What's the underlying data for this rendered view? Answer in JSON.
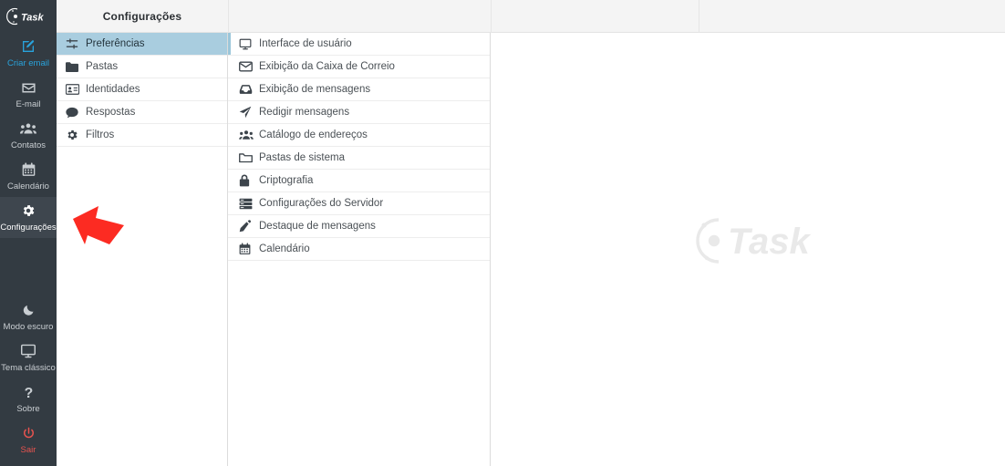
{
  "app": {
    "logo_text": "Task",
    "brand_color": "#29a3dc",
    "rail_bg": "#333b42",
    "selected_row_color": "#a9cddf",
    "logout_color": "#e8534f"
  },
  "header": {
    "title": "Configurações"
  },
  "sidebar": {
    "top_items": [
      {
        "icon": "compose-icon",
        "label": "Criar email",
        "state": "compose"
      },
      {
        "icon": "envelope-icon",
        "label": "E-mail",
        "state": "normal"
      },
      {
        "icon": "contacts-icon",
        "label": "Contatos",
        "state": "normal"
      },
      {
        "icon": "calendar-icon",
        "label": "Calendário",
        "state": "normal"
      },
      {
        "icon": "gear-icon",
        "label": "Configurações",
        "state": "active"
      }
    ],
    "bottom_items": [
      {
        "icon": "moon-icon",
        "label": "Modo escuro",
        "state": "normal"
      },
      {
        "icon": "monitor-icon",
        "label": "Tema clássico",
        "state": "normal"
      },
      {
        "icon": "question-icon",
        "label": "Sobre",
        "state": "normal"
      },
      {
        "icon": "power-icon",
        "label": "Sair",
        "state": "logout"
      }
    ]
  },
  "settings_list": {
    "items": [
      {
        "icon": "sliders-icon",
        "label": "Preferências",
        "selected": true
      },
      {
        "icon": "folder-icon",
        "label": "Pastas",
        "selected": false
      },
      {
        "icon": "idcard-icon",
        "label": "Identidades",
        "selected": false
      },
      {
        "icon": "comment-icon",
        "label": "Respostas",
        "selected": false
      },
      {
        "icon": "gear-icon",
        "label": "Filtros",
        "selected": false
      }
    ]
  },
  "preferences_sections": {
    "items": [
      {
        "icon": "monitor-icon",
        "label": "Interface de usuário",
        "active": true
      },
      {
        "icon": "envelope-icon",
        "label": "Exibição da Caixa de Correio",
        "active": false
      },
      {
        "icon": "inbox-icon",
        "label": "Exibição de mensagens",
        "active": false
      },
      {
        "icon": "send-icon",
        "label": "Redigir mensagens",
        "active": false
      },
      {
        "icon": "contacts-icon",
        "label": "Catálogo de endereços",
        "active": false
      },
      {
        "icon": "folder-open-icon",
        "label": "Pastas de sistema",
        "active": false
      },
      {
        "icon": "lock-icon",
        "label": "Criptografia",
        "active": false
      },
      {
        "icon": "server-icon",
        "label": "Configurações do Servidor",
        "active": false
      },
      {
        "icon": "pencil-icon",
        "label": "Destaque de mensagens",
        "active": false
      },
      {
        "icon": "calendar-icon",
        "label": "Calendário",
        "active": false
      }
    ]
  },
  "content": {
    "watermark_text": "Task"
  },
  "annotation": {
    "arrow_color": "#fc2b22",
    "arrow_direction": "left"
  }
}
